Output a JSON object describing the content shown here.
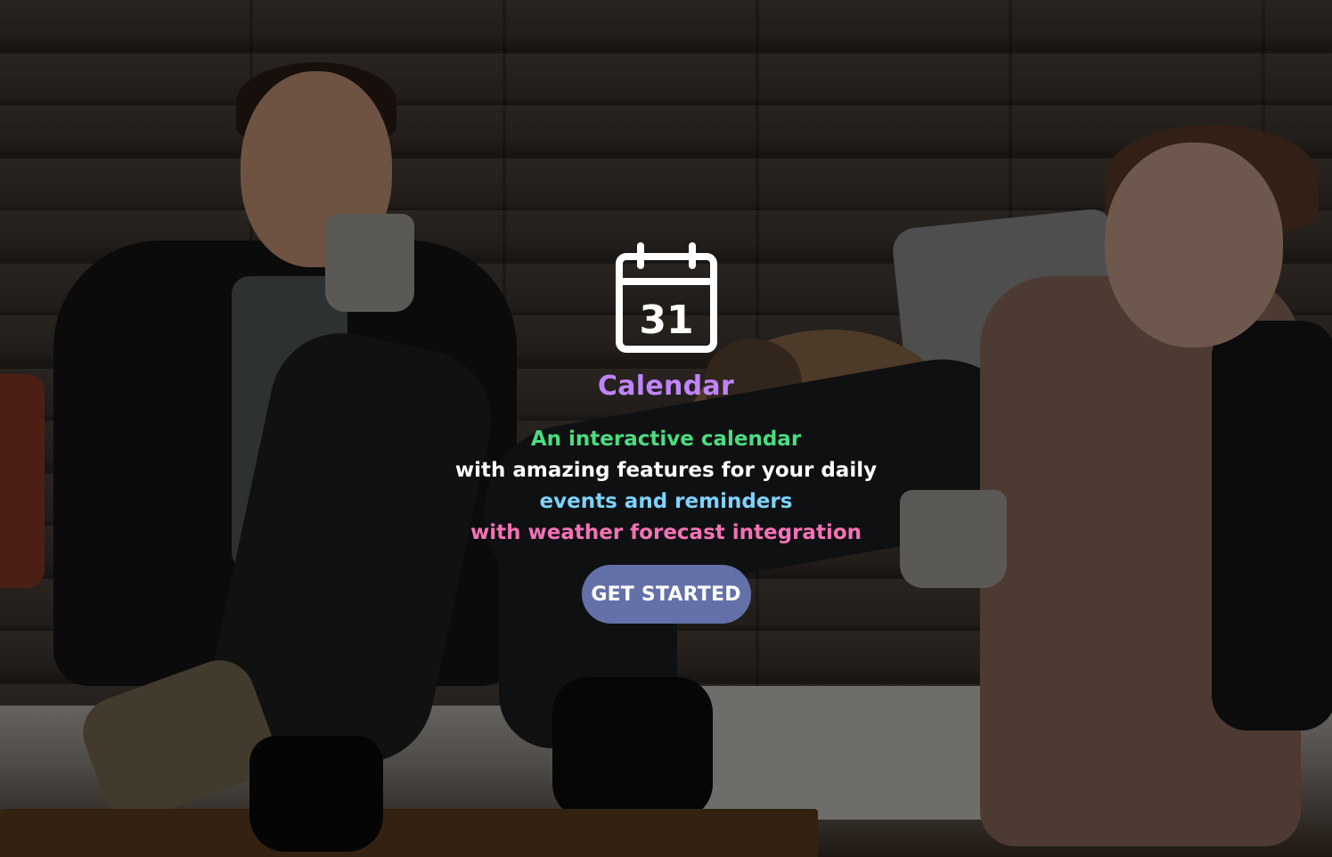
{
  "hero": {
    "icon": "calendar-icon",
    "icon_day": "31",
    "title": "Calendar",
    "tagline": [
      "An interactive calendar",
      "with amazing features for your daily",
      "events and reminders",
      "with weather forecast integration"
    ],
    "cta_label": "GET STARTED"
  },
  "colors": {
    "title": "#c084fc",
    "tagline_line1": "#4ade80",
    "tagline_line2": "#ffffff",
    "tagline_line3": "#7dd3fc",
    "tagline_line4": "#f472b6",
    "cta_background": "#6470a8",
    "icon": "#ffffff"
  }
}
